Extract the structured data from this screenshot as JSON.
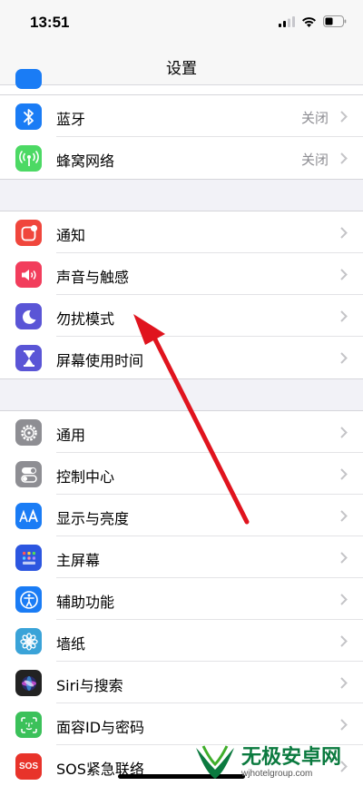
{
  "status_bar": {
    "time": "13:51"
  },
  "nav": {
    "title": "设置"
  },
  "groups": [
    {
      "items": [
        {
          "label": "蓝牙",
          "value": "关闭",
          "icon": "bluetooth-icon",
          "color": "#1a7cf5"
        },
        {
          "label": "蜂窝网络",
          "value": "关闭",
          "icon": "cellular-icon",
          "color": "#4cd964"
        }
      ]
    },
    {
      "items": [
        {
          "label": "通知",
          "icon": "notifications-icon",
          "color": "#f0463c"
        },
        {
          "label": "声音与触感",
          "icon": "sounds-icon",
          "color": "#f23d5c"
        },
        {
          "label": "勿扰模式",
          "icon": "moon-icon",
          "color": "#5a55d6"
        },
        {
          "label": "屏幕使用时间",
          "icon": "hourglass-icon",
          "color": "#5a55d6"
        }
      ]
    },
    {
      "items": [
        {
          "label": "通用",
          "icon": "gear-icon",
          "color": "#8e8e93"
        },
        {
          "label": "控制中心",
          "icon": "toggles-icon",
          "color": "#8e8e93"
        },
        {
          "label": "显示与亮度",
          "icon": "display-aa-icon",
          "color": "#1a7cf5"
        },
        {
          "label": "主屏幕",
          "icon": "home-screen-icon",
          "color": "#2c56e0"
        },
        {
          "label": "辅助功能",
          "icon": "accessibility-icon",
          "color": "#1a7cf5"
        },
        {
          "label": "墙纸",
          "icon": "wallpaper-flower-icon",
          "color": "#3aa3d8"
        },
        {
          "label": "Siri与搜索",
          "icon": "siri-icon",
          "color": "#222222"
        },
        {
          "label": "面容ID与密码",
          "icon": "face-id-icon",
          "color": "#3bc15a"
        },
        {
          "label": "SOS紧急联络",
          "icon": "sos-icon",
          "color": "#e8332a"
        }
      ]
    }
  ],
  "annotation": {
    "color": "#e0141e"
  },
  "watermark": {
    "text": "无极安卓网",
    "url": "wjhotelgroup.com"
  }
}
